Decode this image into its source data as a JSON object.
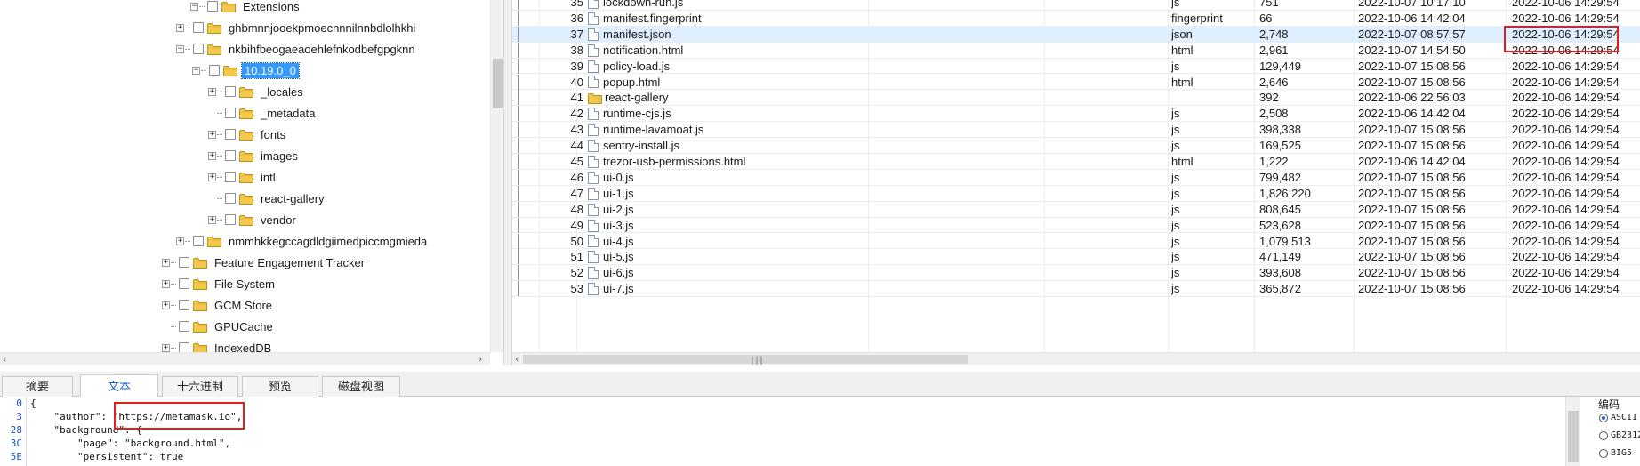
{
  "tree": {
    "items": [
      {
        "label": "Extensions",
        "expanded": true
      },
      {
        "label": "ghbmnnjooekpmoecnnnilnnbdlolhkhi",
        "expanded": false
      },
      {
        "label": "nkbihfbeogaeaoehlefnkodbefgpgknn",
        "expanded": true
      },
      {
        "label": "10.19.0_0",
        "expanded": true,
        "selected": true
      },
      {
        "label": "_locales",
        "expanded": false
      },
      {
        "label": "_metadata",
        "expanded": false
      },
      {
        "label": "fonts",
        "expanded": false
      },
      {
        "label": "images",
        "expanded": false
      },
      {
        "label": "intl",
        "expanded": false
      },
      {
        "label": "react-gallery",
        "expanded": false
      },
      {
        "label": "vendor",
        "expanded": false
      },
      {
        "label": "nmmhkkegccagdldgiimedpiccmgmieda",
        "expanded": false
      },
      {
        "label": "Feature Engagement Tracker",
        "expanded": false
      },
      {
        "label": "File System",
        "expanded": false
      },
      {
        "label": "GCM Store",
        "expanded": false
      },
      {
        "label": "GPUCache",
        "expanded": false
      },
      {
        "label": "IndexedDB",
        "expanded": false
      }
    ]
  },
  "files": {
    "rows": [
      {
        "num": "35",
        "name": "lockdown-run.js",
        "type": "js",
        "size": "751",
        "created": "2022-10-07 10:17:10",
        "modified": "2022-10-06 14:29:54",
        "kind": "file"
      },
      {
        "num": "36",
        "name": "manifest.fingerprint",
        "type": "fingerprint",
        "size": "66",
        "created": "2022-10-06 14:42:04",
        "modified": "2022-10-06 14:29:54",
        "kind": "file"
      },
      {
        "num": "37",
        "name": "manifest.json",
        "type": "json",
        "size": "2,748",
        "created": "2022-10-07 08:57:57",
        "modified": "2022-10-06 14:29:54",
        "kind": "file",
        "highlight": true
      },
      {
        "num": "38",
        "name": "notification.html",
        "type": "html",
        "size": "2,961",
        "created": "2022-10-07 14:54:50",
        "modified": "2022-10-06 14:29:54",
        "kind": "file"
      },
      {
        "num": "39",
        "name": "policy-load.js",
        "type": "js",
        "size": "129,449",
        "created": "2022-10-07 15:08:56",
        "modified": "2022-10-06 14:29:54",
        "kind": "file"
      },
      {
        "num": "40",
        "name": "popup.html",
        "type": "html",
        "size": "2,646",
        "created": "2022-10-07 15:08:56",
        "modified": "2022-10-06 14:29:54",
        "kind": "file"
      },
      {
        "num": "41",
        "name": "react-gallery",
        "type": "",
        "size": "392",
        "created": "2022-10-06 22:56:03",
        "modified": "2022-10-06 14:29:54",
        "kind": "folder"
      },
      {
        "num": "42",
        "name": "runtime-cjs.js",
        "type": "js",
        "size": "2,508",
        "created": "2022-10-06 14:42:04",
        "modified": "2022-10-06 14:29:54",
        "kind": "file"
      },
      {
        "num": "43",
        "name": "runtime-lavamoat.js",
        "type": "js",
        "size": "398,338",
        "created": "2022-10-07 15:08:56",
        "modified": "2022-10-06 14:29:54",
        "kind": "file"
      },
      {
        "num": "44",
        "name": "sentry-install.js",
        "type": "js",
        "size": "169,525",
        "created": "2022-10-07 15:08:56",
        "modified": "2022-10-06 14:29:54",
        "kind": "file"
      },
      {
        "num": "45",
        "name": "trezor-usb-permissions.html",
        "type": "html",
        "size": "1,222",
        "created": "2022-10-06 14:42:04",
        "modified": "2022-10-06 14:29:54",
        "kind": "file"
      },
      {
        "num": "46",
        "name": "ui-0.js",
        "type": "js",
        "size": "799,482",
        "created": "2022-10-07 15:08:56",
        "modified": "2022-10-06 14:29:54",
        "kind": "file"
      },
      {
        "num": "47",
        "name": "ui-1.js",
        "type": "js",
        "size": "1,826,220",
        "created": "2022-10-07 15:08:56",
        "modified": "2022-10-06 14:29:54",
        "kind": "file"
      },
      {
        "num": "48",
        "name": "ui-2.js",
        "type": "js",
        "size": "808,645",
        "created": "2022-10-07 15:08:56",
        "modified": "2022-10-06 14:29:54",
        "kind": "file"
      },
      {
        "num": "49",
        "name": "ui-3.js",
        "type": "js",
        "size": "523,628",
        "created": "2022-10-07 15:08:56",
        "modified": "2022-10-06 14:29:54",
        "kind": "file"
      },
      {
        "num": "50",
        "name": "ui-4.js",
        "type": "js",
        "size": "1,079,513",
        "created": "2022-10-07 15:08:56",
        "modified": "2022-10-06 14:29:54",
        "kind": "file"
      },
      {
        "num": "51",
        "name": "ui-5.js",
        "type": "js",
        "size": "471,149",
        "created": "2022-10-07 15:08:56",
        "modified": "2022-10-06 14:29:54",
        "kind": "file"
      },
      {
        "num": "52",
        "name": "ui-6.js",
        "type": "js",
        "size": "393,608",
        "created": "2022-10-07 15:08:56",
        "modified": "2022-10-06 14:29:54",
        "kind": "file"
      },
      {
        "num": "53",
        "name": "ui-7.js",
        "type": "js",
        "size": "365,872",
        "created": "2022-10-07 15:08:56",
        "modified": "2022-10-06 14:29:54",
        "kind": "file"
      }
    ]
  },
  "tabs": [
    {
      "label": "摘要",
      "active": false
    },
    {
      "label": "文本",
      "active": true
    },
    {
      "label": "十六进制",
      "active": false
    },
    {
      "label": "预览",
      "active": false
    },
    {
      "label": "磁盘视图",
      "active": false
    }
  ],
  "preview": {
    "gutter": [
      "0",
      "3",
      "28",
      "3C",
      "5E"
    ],
    "lines": [
      "{",
      "    \"author\": \"https://metamask.io\",",
      "    \"background\": {",
      "        \"page\": \"background.html\",",
      "        \"persistent\": true"
    ]
  },
  "encoding": {
    "title": "编码",
    "options": [
      {
        "label": "ASCII",
        "selected": true
      },
      {
        "label": "GB2312",
        "selected": false
      },
      {
        "label": "BIG5",
        "selected": false
      }
    ]
  },
  "colors": {
    "selection": "#3399ff",
    "row_highlight": "#e0efff",
    "annotation_red": "#e02020",
    "active_tab_text": "#1e64c8",
    "folder_yellow": "#f2c94c"
  },
  "icons": {
    "folder": "folder-icon",
    "file": "file-icon",
    "expand": "expand-toggle-icon",
    "checkbox": "checkbox-icon"
  }
}
